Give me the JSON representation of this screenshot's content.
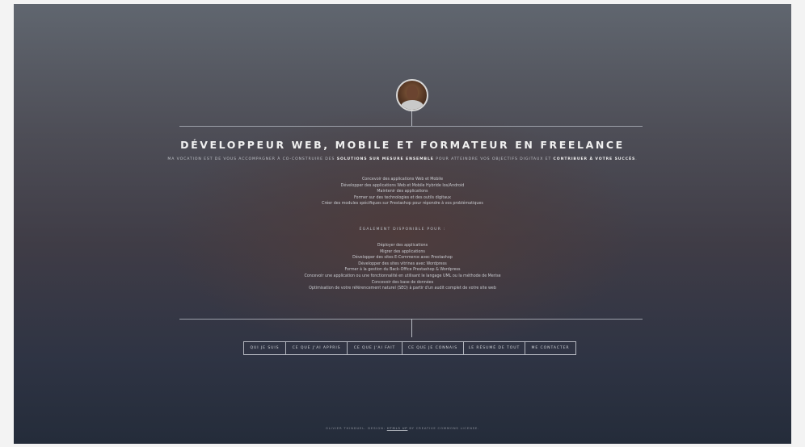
{
  "profile": {
    "avatar_icon": "person-photo-icon"
  },
  "title": "DÉVELOPPEUR WEB, MOBILE ET FORMATEUR EN FREELANCE",
  "intro": {
    "part1": "Ma vocation est de vous accompagner à co-construire des",
    "bold1": "solutions sur mesure ensemble",
    "part2": "pour atteindre vos objectifs digitaux et",
    "bold2": "contribuer à votre succès"
  },
  "services": [
    "Concevoir des applications Web et Mobile",
    "Développer des applications Web et Mobile Hybride Ios/Android",
    "Maintenir des applications",
    "Former sur des technologies et des outils digitaux",
    "Créer des modules spécifiques sur Prestashop pour répondre à vos problématiques"
  ],
  "also_available_label": "Également disponible pour :",
  "also_available": [
    "Déployer des applications",
    "Migrer des applications",
    "Développer des sites E-Commerce avec Prestashop",
    "Développer des sites vitrines avec Wordpress",
    "Former à la gestion du Back-Office Prestashop & Wordpress",
    "Concevoir une application ou une fonctionnalité en utilisant le langage UML ou la méthode de Merise",
    "Concevoir des base de données",
    "Optimisation de votre référencement naturel (SEO) à partir d'un audit complet de votre site web"
  ],
  "nav": [
    {
      "label": "Qui je suis"
    },
    {
      "label": "Ce que j'ai appris"
    },
    {
      "label": "Ce que j'ai fait"
    },
    {
      "label": "Ce que je connais"
    },
    {
      "label": "Le résumé de tout"
    },
    {
      "label": "Me contacter"
    }
  ],
  "footer": {
    "text": "Olivier Thinduel. Design:",
    "link": "HTML5 UP",
    "suffix": "by Creative Commons License."
  }
}
